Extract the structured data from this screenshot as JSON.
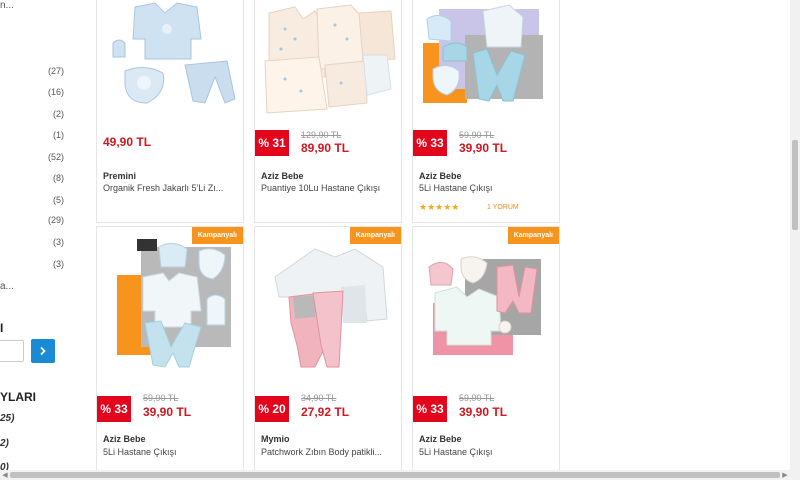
{
  "sidebar": {
    "more_top": "n...",
    "counts": [
      "(27)",
      "(16)",
      "(2)",
      "(1)",
      "(52)",
      "(8)",
      "(5)",
      "(29)",
      "(3)",
      "(3)"
    ],
    "more_bottom": "a...",
    "price_heading": "I",
    "go_icon": "chevron-right-icon",
    "ratings_heading": "YLARI",
    "rating_counts": [
      "25)",
      "2)",
      "0)"
    ]
  },
  "products": [
    {
      "price": "49,90 TL",
      "brand": "Premini",
      "name": "Organik Fresh Jakarlı 5'Li Zı..."
    },
    {
      "discount": "% 31",
      "old_price": "129,90 TL",
      "price": "89,90 TL",
      "brand": "Aziz Bebe",
      "name": "Puantiye 10Lu Hastane Çıkışı"
    },
    {
      "discount": "% 33",
      "old_price": "59,90 TL",
      "price": "39,90 TL",
      "brand": "Aziz Bebe",
      "name": "5Li Hastane Çıkışı",
      "stars": "★★★★★",
      "rating": 5,
      "review": "1 YORUM"
    },
    {
      "badge": "Kampanyalı",
      "discount": "% 33",
      "old_price": "59,90 TL",
      "price": "39,90 TL",
      "brand": "Aziz Bebe",
      "name": "5Li Hastane Çıkışı"
    },
    {
      "badge": "Kampanyalı",
      "discount": "% 20",
      "old_price": "34,90 TL",
      "price": "27,92 TL",
      "brand": "Mymio",
      "name": "Patchwork Zıbın Body patikli..."
    },
    {
      "badge": "Kampanyalı",
      "discount": "% 33",
      "old_price": "59,90 TL",
      "price": "39,90 TL",
      "brand": "Aziz Bebe",
      "name": "5Li Hastane Çıkışı"
    }
  ],
  "colors": {
    "price": "#d2161e",
    "discount_bg": "#e3051b",
    "badge_bg": "#f7941d",
    "accent_button": "#1a8ad4",
    "stars": "#f5a623"
  }
}
